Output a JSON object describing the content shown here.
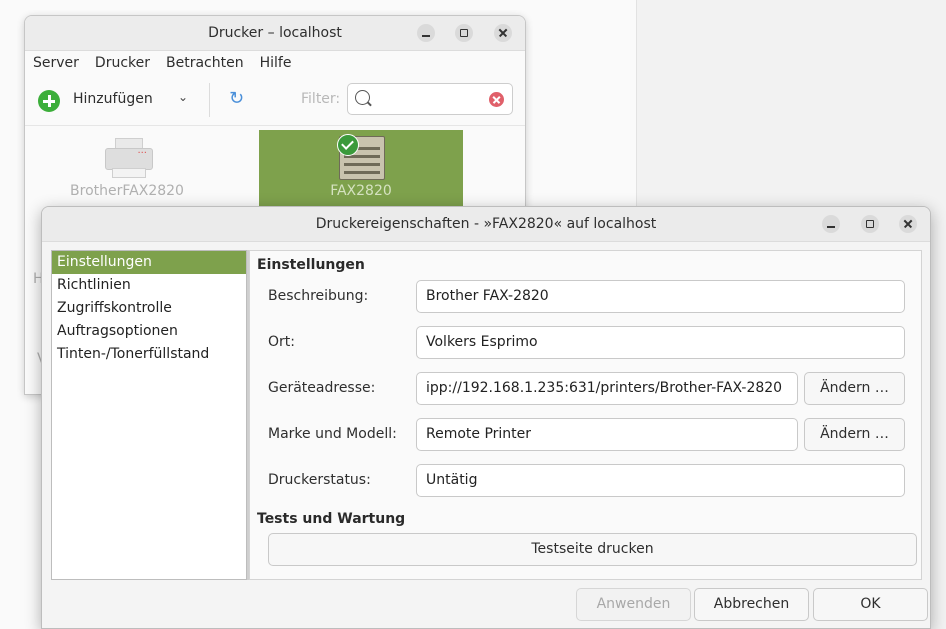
{
  "back_window": {
    "title": "Drucker – localhost",
    "menu": [
      "Server",
      "Drucker",
      "Betrachten",
      "Hilfe"
    ],
    "toolbar": {
      "add_label": "Hinzufügen",
      "filter_label": "Filter:",
      "filter_value": ""
    },
    "printers": [
      {
        "name": "BrotherFAX2820",
        "selected": false
      },
      {
        "name": "FAX2820",
        "selected": true
      }
    ],
    "peek_texts": [
      "H",
      "V"
    ]
  },
  "dialog": {
    "title": "Druckereigenschaften - »FAX2820« auf localhost",
    "sidebar": [
      {
        "label": "Einstellungen",
        "active": true
      },
      {
        "label": "Richtlinien",
        "active": false
      },
      {
        "label": "Zugriffskontrolle",
        "active": false
      },
      {
        "label": "Auftragsoptionen",
        "active": false
      },
      {
        "label": "Tinten-/Tonerfüllstand",
        "active": false
      }
    ],
    "settings_header": "Einstellungen",
    "fields": {
      "description": {
        "label": "Beschreibung:",
        "value": "Brother FAX-2820"
      },
      "location": {
        "label": "Ort:",
        "value": "Volkers Esprimo"
      },
      "device_uri": {
        "label": "Geräteadresse:",
        "value": "ipp://192.168.1.235:631/printers/Brother-FAX-2820",
        "button": "Ändern …"
      },
      "make_model": {
        "label": "Marke und Modell:",
        "value": "Remote Printer",
        "button": "Ändern …"
      },
      "status": {
        "label": "Druckerstatus:",
        "value": "Untätig"
      }
    },
    "tests_header": "Tests und Wartung",
    "print_test_button": "Testseite drucken",
    "buttons": {
      "apply": "Anwenden",
      "cancel": "Abbrechen",
      "ok": "OK"
    }
  },
  "colors": {
    "selection": "#7ea14c",
    "add_green": "#3cae3a",
    "clear_red": "#e0606a"
  }
}
